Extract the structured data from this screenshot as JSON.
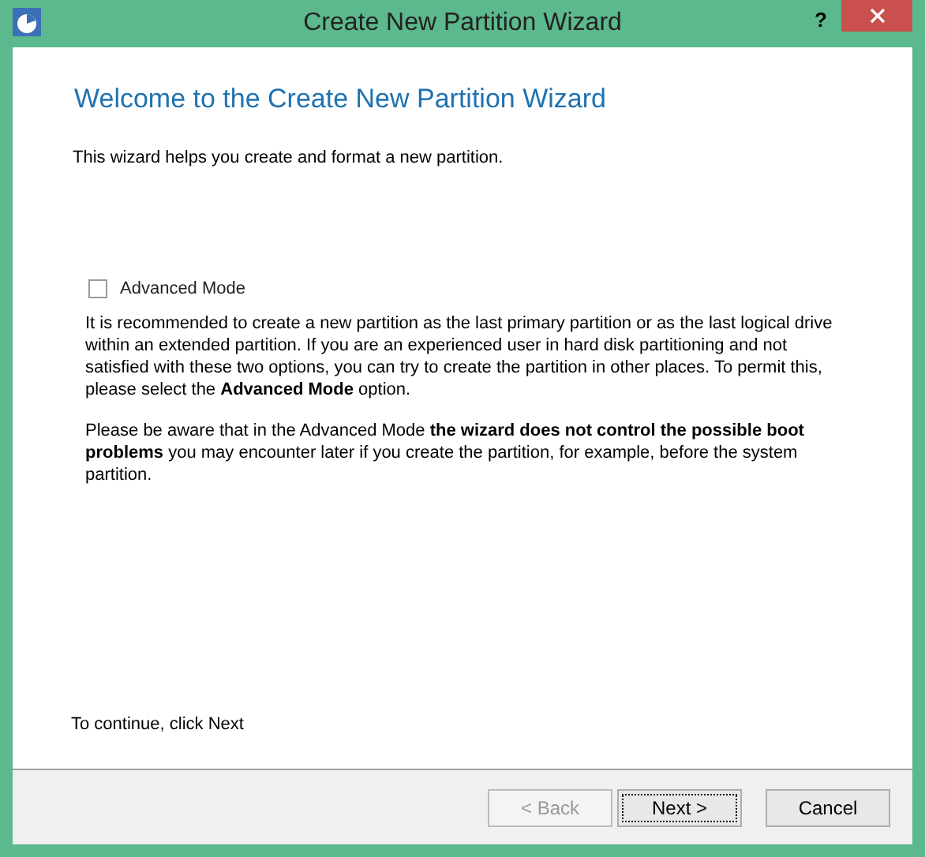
{
  "window": {
    "title": "Create New Partition Wizard",
    "help": "?"
  },
  "heading": "Welcome to the Create New Partition Wizard",
  "intro": "This wizard helps you create and format a new partition.",
  "advanced_mode": {
    "label": "Advanced Mode",
    "checked": false
  },
  "paragraphs": [
    "It is recommended to create a new partition as the last primary partition or as the last logical drive within an extended partition. If you are an experienced user in hard disk partitioning and not satisfied with these two options, you can try to create the partition in other places. To permit this, please select the **Advanced Mode** option.",
    "Please be aware that in the Advanced Mode **the wizard does not control the possible boot problems** you may encounter later if you create the partition, for example, before the system partition."
  ],
  "footer_text": "To continue, click Next",
  "buttons": [
    {
      "label": "< Back",
      "disabled": true,
      "focused": false
    },
    {
      "label": "Next >",
      "disabled": false,
      "focused": true
    },
    {
      "label": "Cancel",
      "disabled": false,
      "focused": false
    }
  ]
}
